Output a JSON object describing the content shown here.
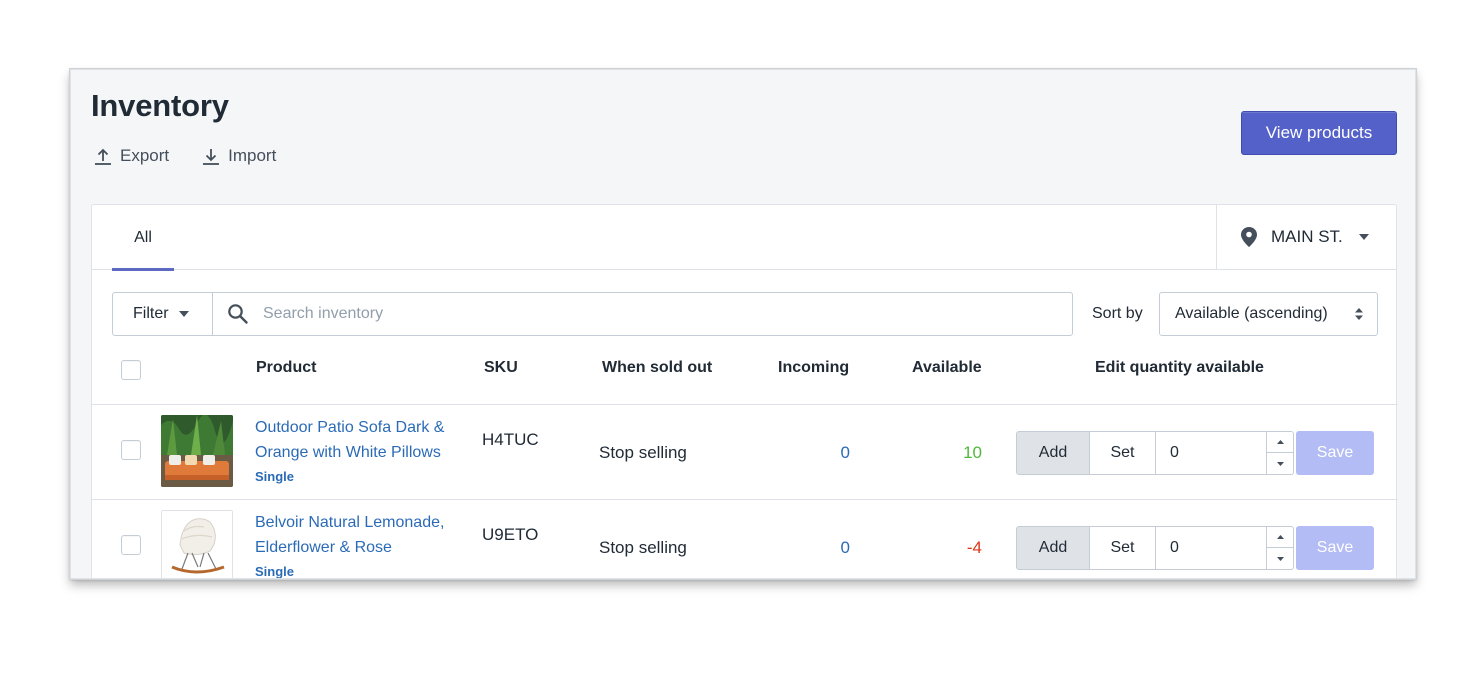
{
  "page": {
    "title": "Inventory",
    "export_label": "Export",
    "import_label": "Import",
    "primary_button": "View products"
  },
  "tabs": {
    "all_label": "All"
  },
  "location": {
    "label": "MAIN ST."
  },
  "filter": {
    "button_label": "Filter",
    "search_placeholder": "Search inventory",
    "sort_label": "Sort by",
    "sort_value": "Available (ascending)"
  },
  "table": {
    "headers": {
      "product": "Product",
      "sku": "SKU",
      "when_sold_out": "When sold out",
      "incoming": "Incoming",
      "available": "Available",
      "edit_quantity": "Edit quantity available"
    },
    "rows": [
      {
        "name_line1": "Outdoor Patio Sofa Dark &",
        "name_line2": "Orange with White Pillows",
        "variant": "Single",
        "sku": "H4TUC",
        "when_sold_out": "Stop selling",
        "incoming": "0",
        "available": "10",
        "available_color": "#50b83c",
        "add_label": "Add",
        "set_label": "Set",
        "quantity": "0",
        "save_label": "Save"
      },
      {
        "name_line1": "Belvoir Natural Lemonade,",
        "name_line2": "Elderflower & Rose",
        "variant": "Single",
        "sku": "U9ETO",
        "when_sold_out": "Stop selling",
        "incoming": "0",
        "available": "-4",
        "available_color": "#de3618",
        "add_label": "Add",
        "set_label": "Set",
        "quantity": "0",
        "save_label": "Save"
      }
    ]
  },
  "colors": {
    "primary": "#5c6ac4",
    "link": "#2b6bb6",
    "positive": "#50b83c",
    "negative": "#de3618",
    "save_disabled": "#b3bcf5"
  }
}
